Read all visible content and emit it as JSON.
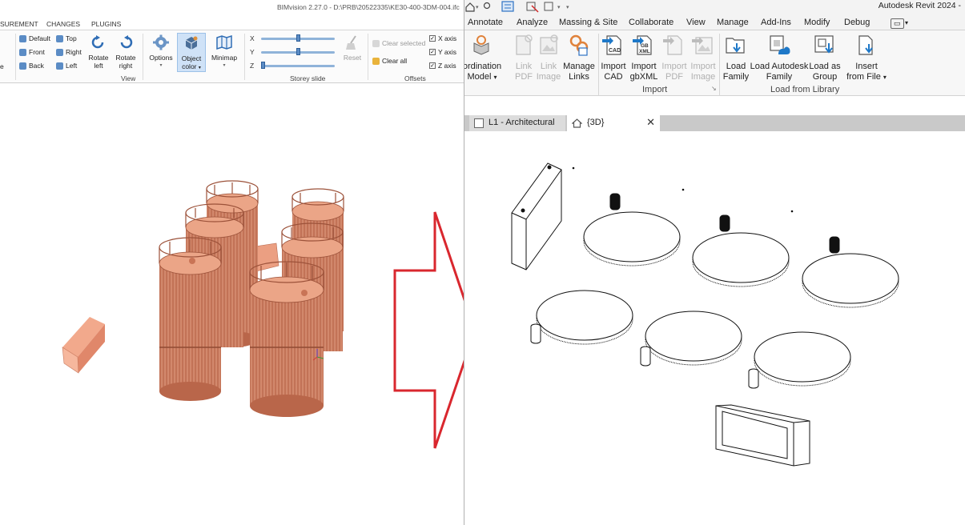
{
  "bimvision": {
    "title": "BIMvision 2.27.0 - D:\\PRB\\20522335\\KE30-400-3DM-004.ifc",
    "tabs": [
      "SUREMENT",
      "CHANGES",
      "PLUGINS"
    ],
    "view_buttons": {
      "default": "Default",
      "top": "Top",
      "front": "Front",
      "right": "Right",
      "back": "Back",
      "left": "Left",
      "rotate_left": [
        "Rotate",
        "left"
      ],
      "rotate_right": [
        "Rotate",
        "right"
      ]
    },
    "options_label": "Options",
    "object_color_label": [
      "Object",
      "color"
    ],
    "minimap_label": "Minimap",
    "view_group": "View",
    "storey_slide": {
      "x": "X",
      "y": "Y",
      "z": "Z",
      "reset": "Reset",
      "group": "Storey slide"
    },
    "offsets": {
      "clear_selected": "Clear selected",
      "clear_all": "Clear all",
      "x_axis": "X axis",
      "y_axis": "Y axis",
      "z_axis": "Z axis",
      "group": "Offsets"
    },
    "left_edge_fragment": "e"
  },
  "revit": {
    "app_title": "Autodesk Revit 2024 -",
    "menu_tabs": [
      "Annotate",
      "Analyze",
      "Massing & Site",
      "Collaborate",
      "View",
      "Manage",
      "Add-Ins",
      "Modify",
      "Debug"
    ],
    "ribbon": {
      "coordination_model": [
        "ordination",
        "Model"
      ],
      "link_pdf": [
        "Link",
        "PDF"
      ],
      "link_image": [
        "Link",
        "Image"
      ],
      "manage_links": [
        "Manage",
        "Links"
      ],
      "import_cad": [
        "Import",
        "CAD"
      ],
      "import_gbxml": [
        "Import",
        "gbXML"
      ],
      "import_pdf": [
        "Import",
        "PDF"
      ],
      "import_image": [
        "Import",
        "Image"
      ],
      "load_family": [
        "Load",
        "Family"
      ],
      "load_autodesk_family": [
        "Load Autodesk",
        "Family"
      ],
      "load_as_group": [
        "Load as",
        "Group"
      ],
      "insert_from_file": [
        "Insert",
        "from File"
      ],
      "import_group": "Import",
      "load_group": "Load from Library"
    },
    "view_tabs": [
      {
        "label": "L1 - Architectural",
        "active": false
      },
      {
        "label": "{3D}",
        "active": true
      }
    ],
    "icons": {
      "cad_badge": "CAD",
      "gbxml_badge": [
        "GB",
        "XML"
      ]
    }
  },
  "colors": {
    "model_fill": "#e49a7e",
    "model_dark": "#a75e44",
    "arrow_red": "#d9272e",
    "revit_blue": "#1e78c8"
  }
}
